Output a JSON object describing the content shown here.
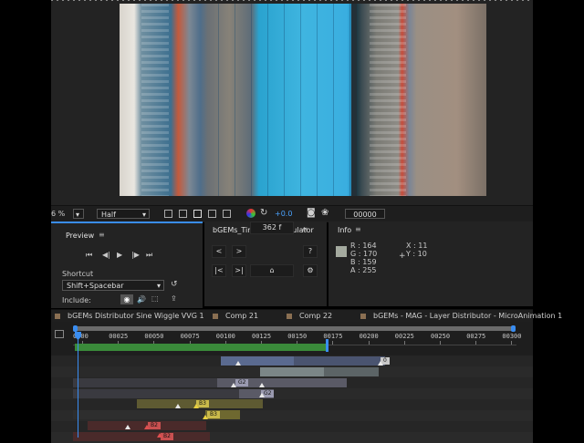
{
  "viewer": {
    "zoom_partial": "6 %",
    "resolution": "Half",
    "exposure": "+0.0",
    "timecode": "00000"
  },
  "preview": {
    "title": "Preview",
    "shortcut_label": "Shortcut",
    "shortcut_value": "Shift+Spacebar",
    "include_label": "Include:"
  },
  "timespan": {
    "title": "bGEMs_TimespanCalculator",
    "frames": "362 f",
    "help": "?"
  },
  "info": {
    "title": "Info",
    "r": "R : 164",
    "g": "G : 170",
    "b": "B : 159",
    "a": "A : 255",
    "x": "X : 11",
    "y": "Y : 10",
    "swatch": "#a4aa9f"
  },
  "timeline": {
    "tabs": [
      {
        "label": "bGEMs Distributor Sine Wiggle VVG 1"
      },
      {
        "label": "Comp 21"
      },
      {
        "label": "Comp 22"
      },
      {
        "label": "bGEMs - MAG - Layer Distributor - MicroAnimation 1"
      }
    ],
    "ticks": [
      "0000",
      "00025",
      "00050",
      "00075",
      "00100",
      "00125",
      "00150",
      "00175",
      "00200",
      "00225",
      "00250",
      "00275",
      "00300"
    ],
    "labels": [
      "0",
      "G2",
      "G2",
      "B3",
      "B3",
      "B2",
      "B2"
    ]
  },
  "colors": {
    "accent": "#3a8df0",
    "work_area": "#3a8a3a",
    "panel": "#232323"
  }
}
